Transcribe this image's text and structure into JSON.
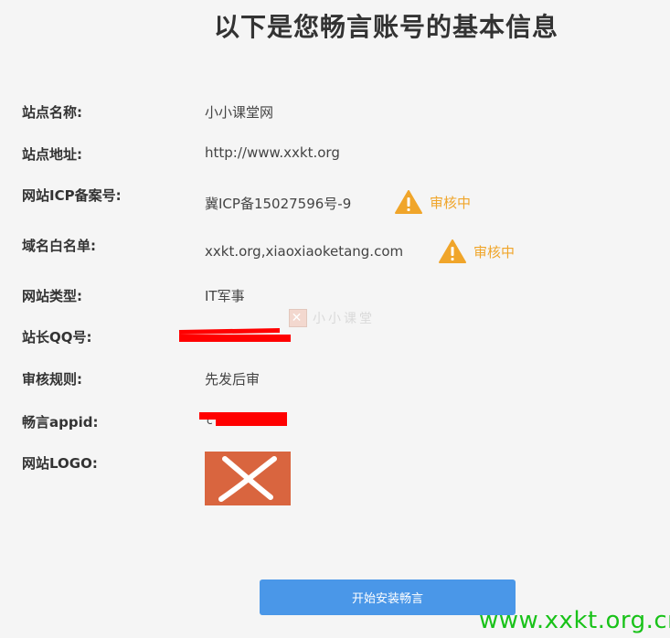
{
  "page": {
    "title": "以下是您畅言账号的基本信息"
  },
  "fields": [
    {
      "label": "站点名称:",
      "value": "小小课堂网"
    },
    {
      "label": "站点地址:",
      "value": "http://www.xxkt.org"
    },
    {
      "label": "网站ICP备案号:",
      "value": "冀ICP备15027596号-9",
      "status": "审核中"
    },
    {
      "label": "域名白名单:",
      "value": "xxkt.org,xiaoxiaoketang.com",
      "status": "审核中"
    },
    {
      "label": "网站类型:",
      "value": "IT军事"
    },
    {
      "label": "站长QQ号:"
    },
    {
      "label": "审核规则:",
      "value": "先发后审"
    },
    {
      "label": "畅言appid:",
      "value": "c"
    },
    {
      "label": "网站LOGO:"
    }
  ],
  "watermark": {
    "text": "小小课堂"
  },
  "button": {
    "label": "开始安装畅言"
  },
  "site_watermark": "www.xxkt.org.cn",
  "colors": {
    "warning": "#f0a52a",
    "button": "#4a97e8",
    "redaction": "#ff0000",
    "logo_bg": "#d9653f",
    "site_watermark": "#19c219"
  },
  "icons": {
    "warning": "warning-triangle-icon",
    "logo": "cross-logo-icon"
  }
}
